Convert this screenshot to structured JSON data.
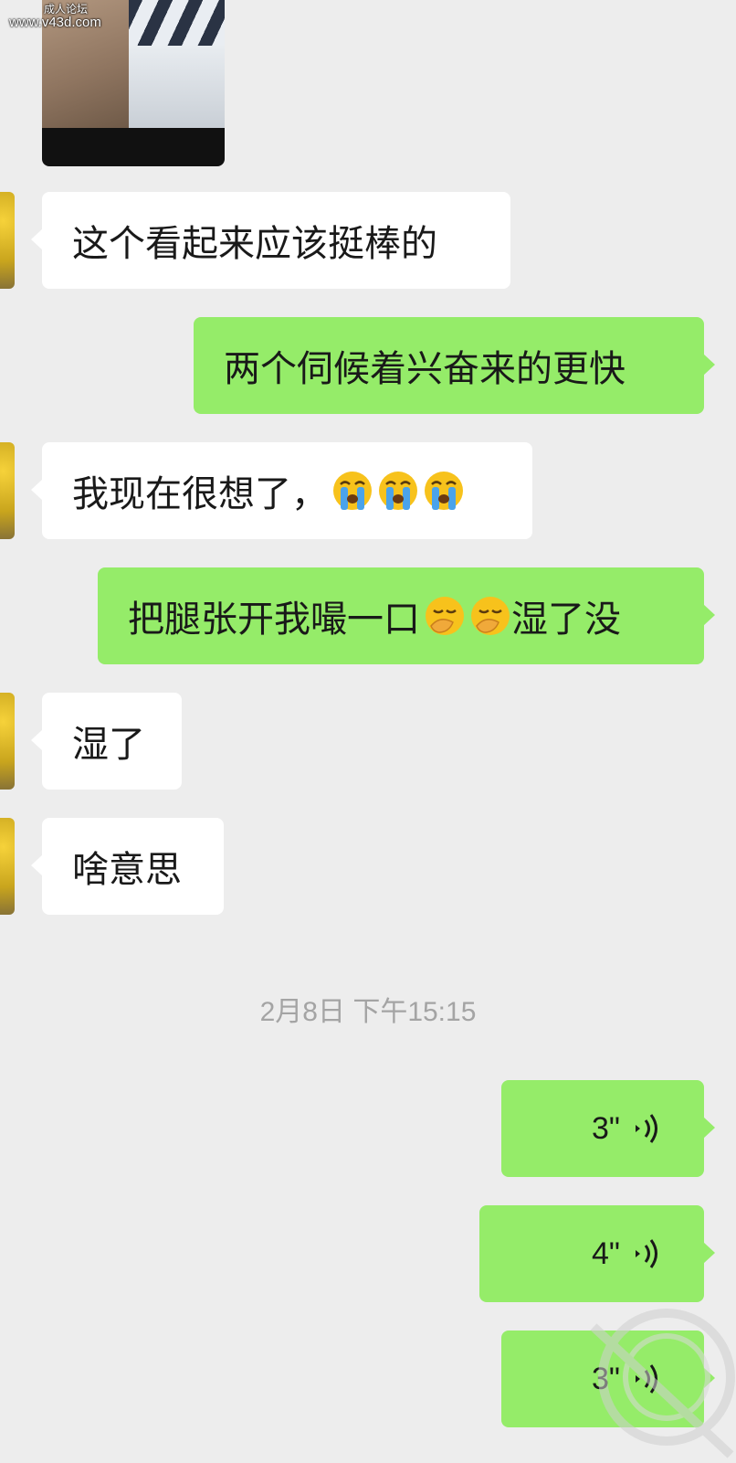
{
  "watermark": {
    "line1": "成人论坛",
    "line2": "www.v43d.com"
  },
  "messages": [
    {
      "side": "left",
      "text": "这个看起来应该挺棒的"
    },
    {
      "side": "right",
      "text": "两个伺候着兴奋来的更快"
    },
    {
      "side": "left",
      "text": "我现在很想了，",
      "emoji": [
        "loudly-crying-face",
        "loudly-crying-face",
        "loudly-crying-face"
      ]
    },
    {
      "side": "right",
      "text_before": "把腿张开我嘬一口",
      "emoji": [
        "hand-over-mouth-face",
        "hand-over-mouth-face"
      ],
      "text_after": "湿了没"
    },
    {
      "side": "left",
      "text": "湿了"
    },
    {
      "side": "left",
      "text": "啥意思"
    }
  ],
  "timestamp": "2月8日 下午15:15",
  "voice_messages": [
    {
      "side": "right",
      "duration": "3\"",
      "icon": "voice-wave-icon"
    },
    {
      "side": "right",
      "duration": "4\"",
      "icon": "voice-wave-icon"
    },
    {
      "side": "right",
      "duration": "3\"",
      "icon": "voice-wave-icon"
    }
  ],
  "colors": {
    "background": "#ededed",
    "incoming_bubble": "#ffffff",
    "outgoing_bubble": "#95ec69",
    "text": "#191919",
    "timestamp": "#a4a4a4"
  }
}
